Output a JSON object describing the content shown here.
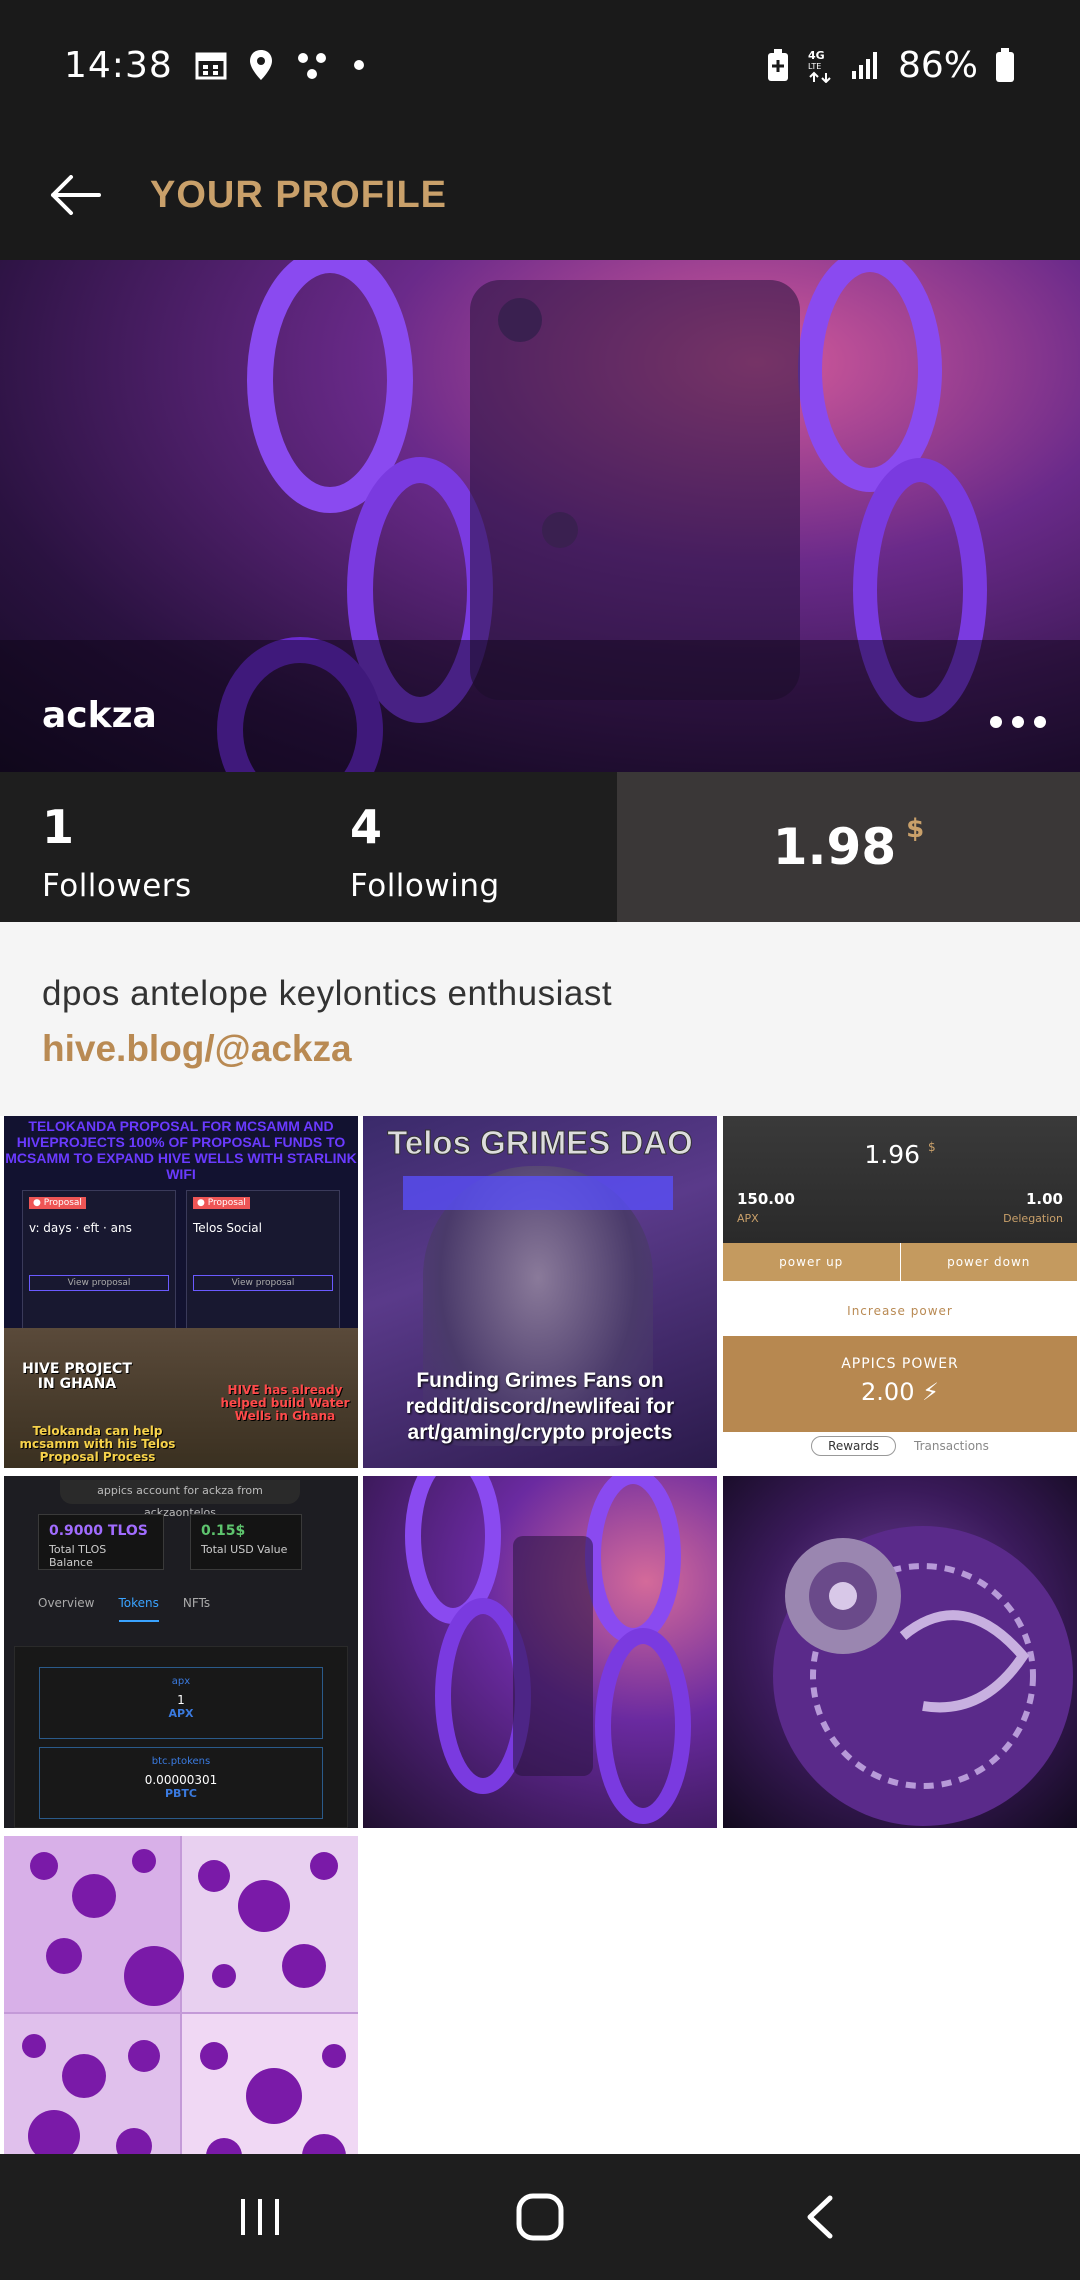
{
  "status_bar": {
    "time": "14:38",
    "battery": "86%",
    "icons_left": [
      "calendar-icon",
      "location-icon",
      "dots-icon",
      "dot-icon"
    ],
    "icons_right": [
      "battery-saver-icon",
      "4g-lte-icon",
      "signal-icon",
      "battery-icon"
    ]
  },
  "header": {
    "title": "YOUR PROFILE",
    "back_icon": "arrow-left-icon"
  },
  "profile": {
    "username": "ackza",
    "followers_count": "1",
    "followers_label": "Followers",
    "following_count": "4",
    "following_label": "Following",
    "balance": "1.98",
    "balance_currency": "$",
    "bio": "dpos antelope keylontics enthusiast",
    "link": "hive.blog/@ackza"
  },
  "grid": {
    "tile1": {
      "headline": "TELOKANDA PROPOSAL FOR MCSAMM AND HIVEPROJECTS 100% OF PROPOSAL FUNDS TO MCSAMM TO EXPAND HIVE WELLS WITH STARLINK WIFI",
      "caption_left": "HIVE PROJECT IN GHANA",
      "caption_right": "HIVE has already helped build Water Wells in Ghana",
      "caption_bottom": "Telokanda can help mcsamm with his Telos Proposal Process"
    },
    "tile2": {
      "title": "Telos GRIMES DAO",
      "caption": "Funding Grimes Fans on reddit/discord/newlifeai for art/gaming/crypto projects"
    },
    "tile3": {
      "value": "1.96",
      "currency": "$",
      "apx_value": "150.00",
      "apx_label": "APX",
      "delegation_value": "1.00",
      "delegation_label": "Delegation",
      "power_up": "power up",
      "power_down": "power down",
      "increase_power": "Increase power",
      "power_title": "APPICS POWER",
      "power_value": "2.00",
      "tab_rewards": "Rewards",
      "tab_transactions": "Transactions"
    },
    "tile4": {
      "account": "appics account for ackza from ackzaontelos",
      "tlos_value": "0.9000 TLOS",
      "tlos_label": "Total TLOS Balance",
      "usd_value": "0.15$",
      "usd_label": "Total USD Value",
      "tabs": [
        "Overview",
        "Tokens",
        "NFTs"
      ],
      "token1_name": "apx",
      "token1_amount": "1",
      "token1_symbol": "APX",
      "token2_name": "btc.ptokens",
      "token2_amount": "0.00000301",
      "token2_symbol": "PBTC"
    }
  },
  "navbar": {
    "recents_icon": "recents-icon",
    "home_icon": "home-icon",
    "back_icon": "back-chevron-icon"
  },
  "colors": {
    "accent": "#c9a06a",
    "background": "#1a1a1a",
    "balance_bg": "#3a3737"
  }
}
